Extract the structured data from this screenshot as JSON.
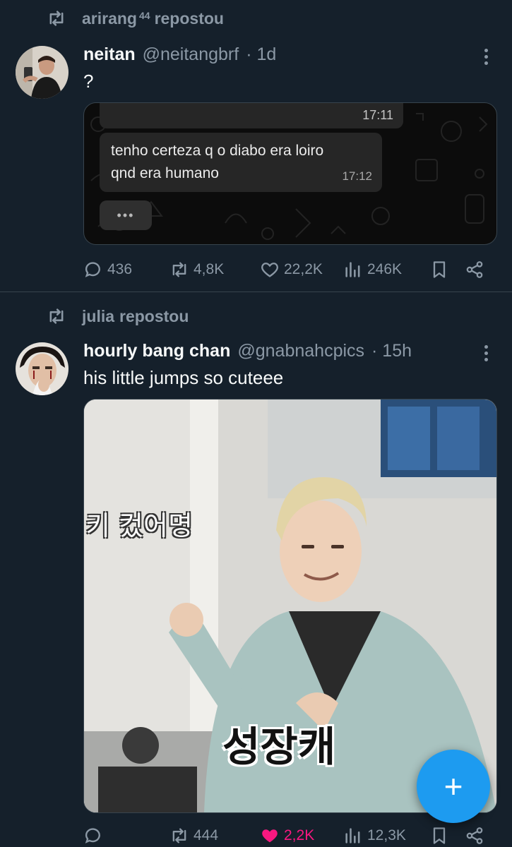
{
  "tweet1": {
    "repost_by": "arirang",
    "repost_by_sup": "44",
    "repost_suffix": "repostou",
    "name": "neitan",
    "handle": "@neitangbrf",
    "age": "· 1d",
    "text": "?",
    "chat": {
      "time_top": "17:11",
      "message_line1": "tenho certeza q o diabo era loiro",
      "message_line2": "qnd era humano",
      "message_time": "17:12",
      "typing": "•••"
    },
    "stats": {
      "replies": "436",
      "reposts": "4,8K",
      "likes": "22,2K",
      "views": "246K"
    }
  },
  "tweet2": {
    "repost_by": "julia",
    "repost_suffix": "repostou",
    "name": "hourly bang chan",
    "handle": "@gnabnahcpics",
    "age": "· 15h",
    "text": "his little jumps so cuteee",
    "media_caption_top": "키 컸어명",
    "media_caption_bottom": "성장캐",
    "stats": {
      "replies": "",
      "reposts": "444",
      "likes": "2,2K",
      "views": "12,3K"
    },
    "liked": true
  },
  "fab": {
    "label": "+"
  },
  "colors": {
    "background": "#15202b",
    "accent": "#1d9bf0",
    "like_active": "#f91880",
    "muted": "#8b98a5"
  },
  "icons": [
    "repost-icon",
    "more-icon",
    "reply-icon",
    "heart-icon",
    "views-icon",
    "bookmark-icon",
    "share-icon",
    "plus-icon"
  ]
}
